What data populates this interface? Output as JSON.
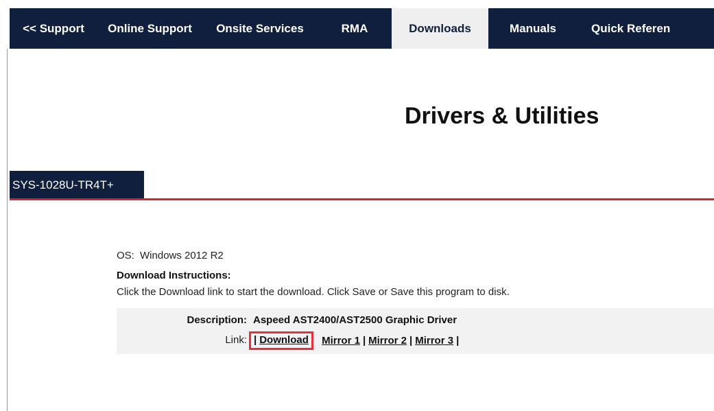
{
  "nav": {
    "items": [
      {
        "label": "<< Support",
        "active": false
      },
      {
        "label": "Online Support",
        "active": false
      },
      {
        "label": "Onsite Services",
        "active": false
      },
      {
        "label": "RMA",
        "active": false
      },
      {
        "label": "Downloads",
        "active": true
      },
      {
        "label": "Manuals",
        "active": false
      },
      {
        "label": "Quick Referen",
        "active": false
      }
    ]
  },
  "page": {
    "title": "Drivers & Utilities",
    "model_tab": "SYS-1028U-TR4T+"
  },
  "os": {
    "label": "OS:",
    "value": "Windows 2012 R2"
  },
  "instructions": {
    "title": "Download Instructions:",
    "text": "Click the Download link to start the download. Click Save or Save this program to disk."
  },
  "download": {
    "description_label": "Description:",
    "description_value": "Aspeed AST2400/AST2500 Graphic Driver",
    "link_label": "Link:",
    "separator": "|",
    "links": [
      "Download",
      "Mirror 1",
      "Mirror 2",
      "Mirror 3"
    ]
  },
  "colors": {
    "nav_bg": "#0f1f3d",
    "active_tab_bg": "#efefef",
    "accent_red": "#d8232f",
    "highlight_box": "#e53238"
  }
}
